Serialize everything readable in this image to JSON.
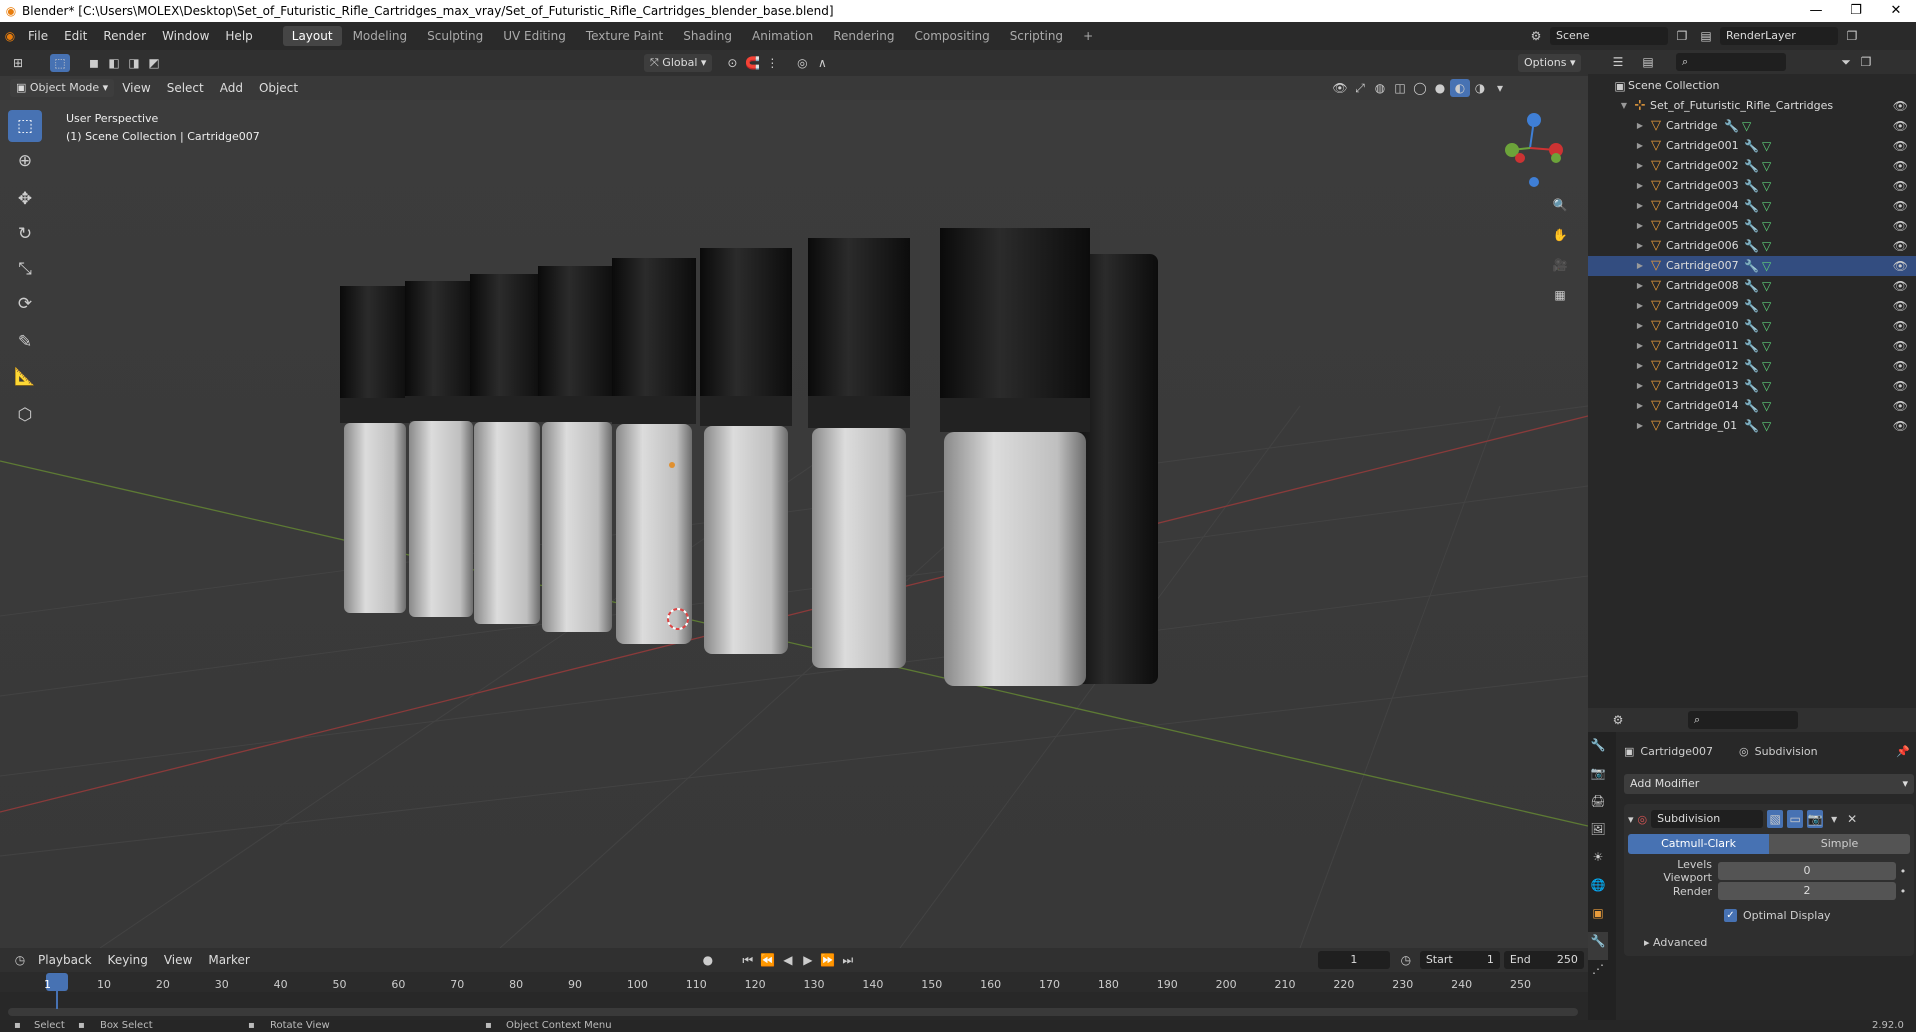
{
  "title": "Blender* [C:\\Users\\MOLEX\\Desktop\\Set_of_Futuristic_Rifle_Cartridges_max_vray/Set_of_Futuristic_Rifle_Cartridges_blender_base.blend]",
  "menus": [
    "File",
    "Edit",
    "Render",
    "Window",
    "Help"
  ],
  "workspaces": [
    "Layout",
    "Modeling",
    "Sculpting",
    "UV Editing",
    "Texture Paint",
    "Shading",
    "Animation",
    "Rendering",
    "Compositing",
    "Scripting"
  ],
  "scene": "Scene",
  "renderlayer": "RenderLayer",
  "transform_orientation": "Global",
  "options": "Options",
  "mode": "Object Mode",
  "vpmenu": [
    "View",
    "Select",
    "Add",
    "Object"
  ],
  "overlay_title": "User Perspective",
  "overlay_sub": "(1) Scene Collection | Cartridge007",
  "outliner": {
    "root": "Scene Collection",
    "collection": "Set_of_Futuristic_Rifle_Cartridges",
    "items": [
      "Cartridge",
      "Cartridge001",
      "Cartridge002",
      "Cartridge003",
      "Cartridge004",
      "Cartridge005",
      "Cartridge006",
      "Cartridge007",
      "Cartridge008",
      "Cartridge009",
      "Cartridge010",
      "Cartridge011",
      "Cartridge012",
      "Cartridge013",
      "Cartridge014",
      "Cartridge_01"
    ]
  },
  "props": {
    "object": "Cartridge007",
    "modifier_tab": "Subdivision",
    "add_modifier": "Add Modifier",
    "mod_name": "Subdivision",
    "catmull": "Catmull-Clark",
    "simple": "Simple",
    "levels_label": "Levels Viewport",
    "levels_val": "0",
    "render_label": "Render",
    "render_val": "2",
    "optimal": "Optimal Display",
    "advanced": "Advanced"
  },
  "timeline": {
    "menus": [
      "Playback",
      "Keying",
      "View",
      "Marker"
    ],
    "frame": "1",
    "start_label": "Start",
    "start": "1",
    "end_label": "End",
    "end": "250",
    "ticks": [
      "1",
      "10",
      "20",
      "30",
      "40",
      "50",
      "60",
      "70",
      "80",
      "90",
      "100",
      "110",
      "120",
      "130",
      "140",
      "150",
      "160",
      "170",
      "180",
      "190",
      "200",
      "210",
      "220",
      "230",
      "240",
      "250"
    ]
  },
  "status": {
    "select": "Select",
    "box": "Box Select",
    "rotate": "Rotate View",
    "context": "Object Context Menu",
    "version": "2.92.0"
  }
}
